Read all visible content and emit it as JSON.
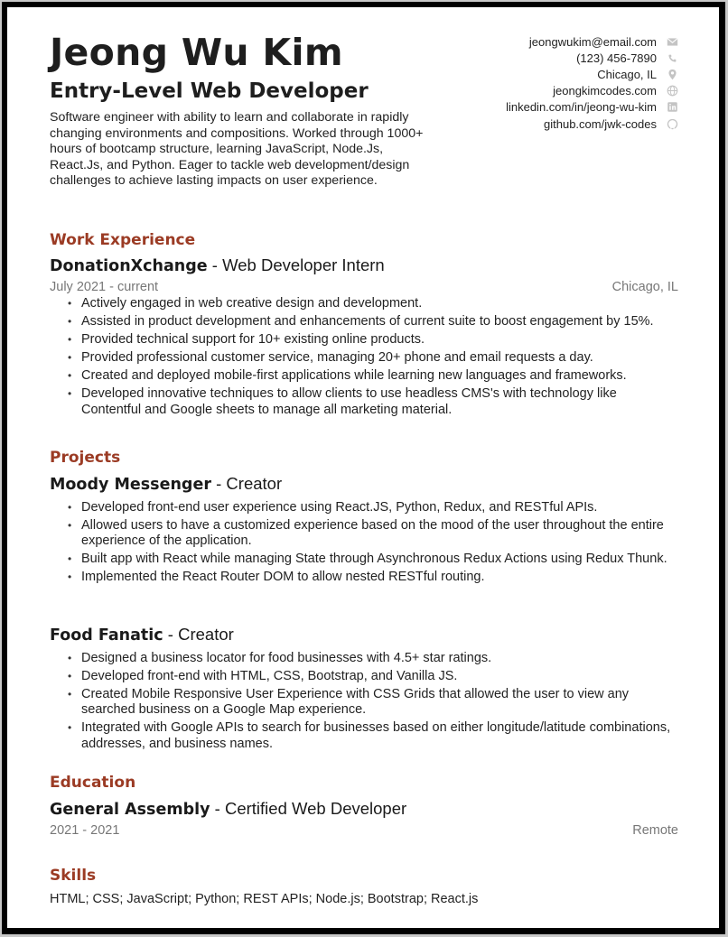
{
  "header": {
    "name": "Jeong Wu Kim",
    "title": "Entry-Level Web Developer",
    "summary": "Software engineer with ability to learn and collaborate in rapidly changing environments and compositions. Worked through 1000+ hours of bootcamp structure, learning JavaScript, Node.Js, React.Js, and Python. Eager to tackle web development/design challenges to achieve lasting impacts on user experience."
  },
  "contacts": [
    {
      "text": "jeongwukim@email.com",
      "icon": "envelope-icon"
    },
    {
      "text": "(123) 456-7890",
      "icon": "phone-icon"
    },
    {
      "text": "Chicago, IL",
      "icon": "location-pin-icon"
    },
    {
      "text": "jeongkimcodes.com",
      "icon": "globe-icon"
    },
    {
      "text": "linkedin.com/in/jeong-wu-kim",
      "icon": "linkedin-icon"
    },
    {
      "text": "github.com/jwk-codes",
      "icon": "github-icon"
    }
  ],
  "colors": {
    "accent": "#9b3b24",
    "meta_text": "#777777",
    "icon": "#c4c4c4"
  },
  "work": {
    "section_title": "Work Experience",
    "entries": [
      {
        "org": "DonationXchange",
        "separator": " - ",
        "role": "Web Developer Intern",
        "dates": "July 2021 - current",
        "location": "Chicago, IL",
        "bullets": [
          "Actively engaged in web creative design and development.",
          "Assisted in product development and enhancements of current suite to boost engagement by 15%.",
          "Provided technical support for 10+ existing online products.",
          "Provided professional customer service, managing 20+ phone and email requests a day.",
          "Created and deployed mobile-first applications while learning new languages and frameworks.",
          "Developed innovative techniques to allow clients to use headless CMS's with technology like Contentful and Google sheets to manage all marketing material."
        ]
      }
    ]
  },
  "projects": {
    "section_title": "Projects",
    "entries": [
      {
        "name": "Moody Messenger",
        "separator": " - ",
        "role": "Creator",
        "bullets": [
          "Developed front-end user experience using React.JS, Python, Redux, and RESTful APIs.",
          "Allowed users to have a customized experience based on the mood of the user throughout the entire experience of the application.",
          "Built app with React while managing State through Asynchronous Redux Actions using Redux Thunk.",
          "Implemented the React Router DOM to allow nested RESTful routing."
        ]
      },
      {
        "name": "Food Fanatic",
        "separator": " - ",
        "role": "Creator",
        "bullets": [
          "Designed a business locator for food businesses with 4.5+ star ratings.",
          "Developed front-end with HTML, CSS, Bootstrap, and Vanilla JS.",
          "Created Mobile Responsive User Experience with CSS Grids that allowed the user to view any searched business on a Google Map experience.",
          "Integrated with Google APIs to search for businesses based on either longitude/latitude combinations, addresses, and business names."
        ]
      }
    ]
  },
  "education": {
    "section_title": "Education",
    "entries": [
      {
        "school": "General Assembly",
        "separator": " - ",
        "credential": "Certified Web Developer",
        "dates": "2021 - 2021",
        "location": "Remote"
      }
    ]
  },
  "skills": {
    "section_title": "Skills",
    "text": "HTML; CSS; JavaScript; Python; REST APIs; Node.js; Bootstrap; React.js"
  }
}
